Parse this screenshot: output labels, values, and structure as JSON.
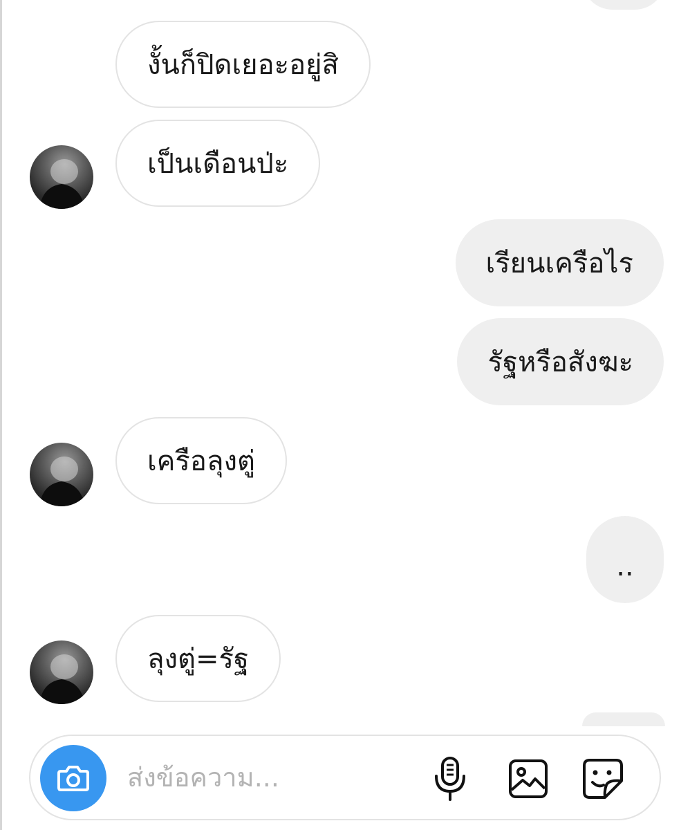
{
  "messages": [
    {
      "side": "in",
      "text": "งั้นก็ปิดเยอะอยู่สิ",
      "avatar": false
    },
    {
      "side": "in",
      "text": "เป็นเดือนป่ะ",
      "avatar": true
    },
    {
      "side": "out",
      "text": "เรียนเครือไร"
    },
    {
      "side": "out",
      "text": "รัฐหรือสังฆะ"
    },
    {
      "side": "in",
      "text": "เครือลุงตู่",
      "avatar": true
    },
    {
      "side": "out",
      "text": ".."
    },
    {
      "side": "in",
      "text": "ลุงตู่=รัฐ",
      "avatar": true
    }
  ],
  "composer": {
    "placeholder": "ส่งข้อความ...",
    "value": "",
    "icons": [
      "camera-icon",
      "microphone-icon",
      "gallery-icon",
      "sticker-icon"
    ]
  },
  "colors": {
    "accent": "#3897f0",
    "incoming_bubble_border": "#e3e3e3",
    "outgoing_bubble_bg": "#efefef",
    "placeholder": "#b3b3b3"
  }
}
